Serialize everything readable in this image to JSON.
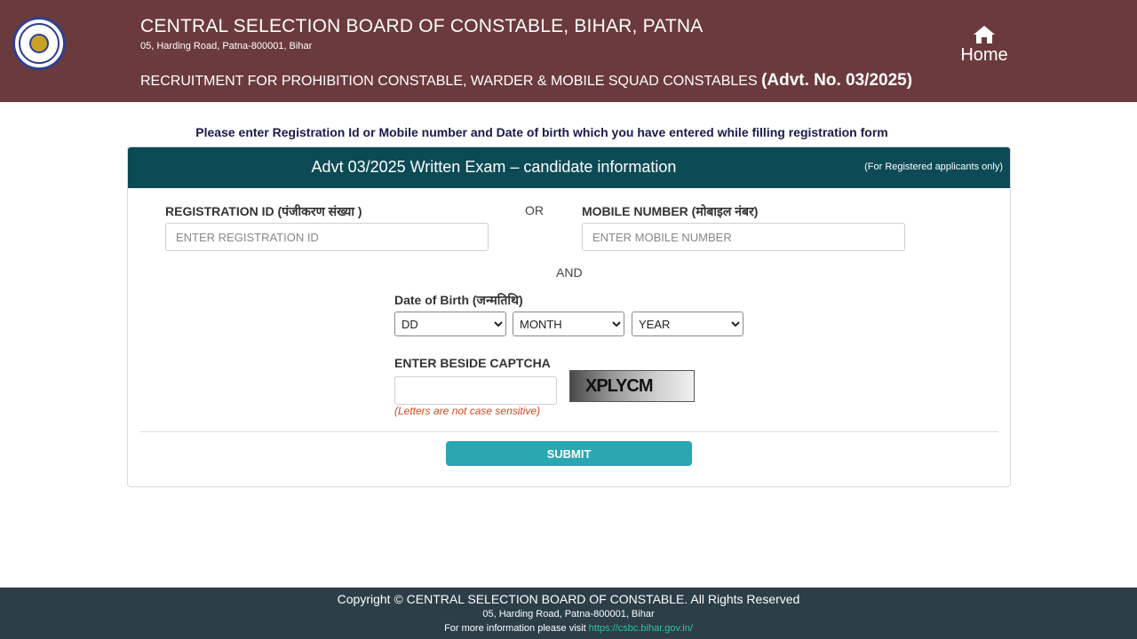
{
  "header": {
    "title": "CENTRAL SELECTION BOARD OF CONSTABLE, BIHAR, PATNA",
    "address": "05, Harding Road, Patna-800001, Bihar",
    "recruitment": "RECRUITMENT FOR PROHIBITION CONSTABLE, WARDER & MOBILE SQUAD CONSTABLES",
    "advt": "(Advt. No. 03/2025)",
    "home_label": "Home",
    "home_icon": "home-icon",
    "bg_color": "#6b3a3d"
  },
  "instruction": "Please enter Registration Id or Mobile number and Date of birth which you have entered while filling registration form",
  "form": {
    "title": "Advt 03/2025 Written Exam – candidate information",
    "note": "(For Registered applicants only)",
    "header_color": "#0c4a55",
    "registration_label": "REGISTRATION ID (पंजीकरण संख्या )",
    "registration_placeholder": "ENTER REGISTRATION ID",
    "or_text": "OR",
    "mobile_label": "MOBILE NUMBER (मोबाइल नंबर)",
    "mobile_placeholder": "ENTER MOBILE NUMBER",
    "and_text": "AND",
    "dob_label": "Date of Birth (जन्मतिथि)",
    "dd_selected": "DD",
    "month_selected": "MONTH",
    "year_selected": "YEAR",
    "captcha_label": "ENTER BESIDE CAPTCHA",
    "captcha_value": "",
    "captcha_text": "XPLYCM",
    "captcha_hint": "(Letters are not case sensitive)",
    "submit_label": "SUBMIT",
    "submit_color": "#2aa7b1"
  },
  "footer": {
    "copyright": "Copyright © CENTRAL SELECTION BOARD OF CONSTABLE. All Rights Reserved",
    "address": "05, Harding Road, Patna-800001, Bihar",
    "info_prefix": "For more information please visit",
    "link": "https://csbc.bihar.gov.in/",
    "bg_color": "#2c3e48"
  }
}
